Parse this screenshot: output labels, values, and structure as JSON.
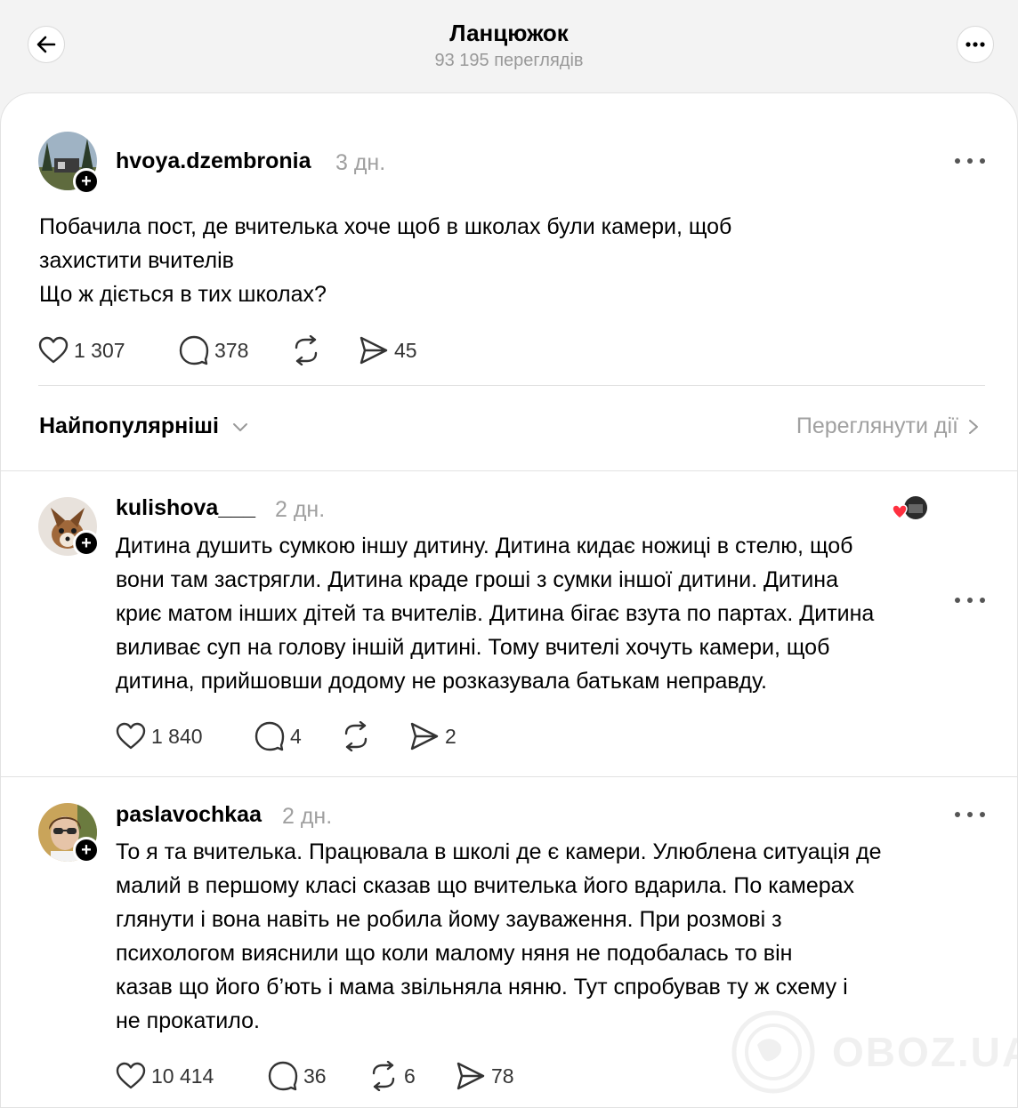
{
  "header": {
    "title": "Ланцюжок",
    "views": "93 195 переглядів"
  },
  "post": {
    "username": "hvoya.dzembronia",
    "time": "3 дн.",
    "text": "Побачила пост, де вчителька хоче щоб в школах були камери, щоб\nзахистити вчителів\nЩо ж діється в тих школах?",
    "likes": "1 307",
    "comments": "378",
    "shares": "45"
  },
  "sort": {
    "label": "Найпопулярніші",
    "view_activity": "Переглянути дії"
  },
  "replies": [
    {
      "username": "kulishova___",
      "time": "2 дн.",
      "text": "Дитина душить сумкою іншу дитину. Дитина кидає ножиці в стелю, щоб\nвони там застрягли. Дитина краде гроші з сумки іншої дитини. Дитина\nкриє матом інших дітей та вчителів. Дитина бігає взута по партах. Дитина\nвиливає суп на голову іншій дитині. Тому вчителі хочуть камери, щоб\nдитина, прийшовши додому не розказувала батькам неправду.",
      "likes": "1 840",
      "comments": "4",
      "shares": "2"
    },
    {
      "username": "paslavochkaa",
      "time": "2 дн.",
      "text": "То я та вчителька. Працювала в школі де є камери. Улюблена ситуація де\nмалий в першому класі сказав що вчителька його вдарила. По камерах\nглянути і вона навіть не робила йому зауваження. При розмові з\nпсихологом вияснили що коли малому няня не подобалась то він\nказав що його б’ють і мама звільняла няню. Тут спробував ту ж схему і\nне прокатило.",
      "likes": "10 414",
      "comments": "36",
      "reposts": "6",
      "shares": "78"
    }
  ],
  "watermark": "OBOZ.UA",
  "icons": [
    "back-arrow-icon",
    "more-icon",
    "heart-icon",
    "comment-icon",
    "repost-icon",
    "share-icon",
    "chevron-down-icon",
    "chevron-right-icon",
    "globe-icon"
  ]
}
